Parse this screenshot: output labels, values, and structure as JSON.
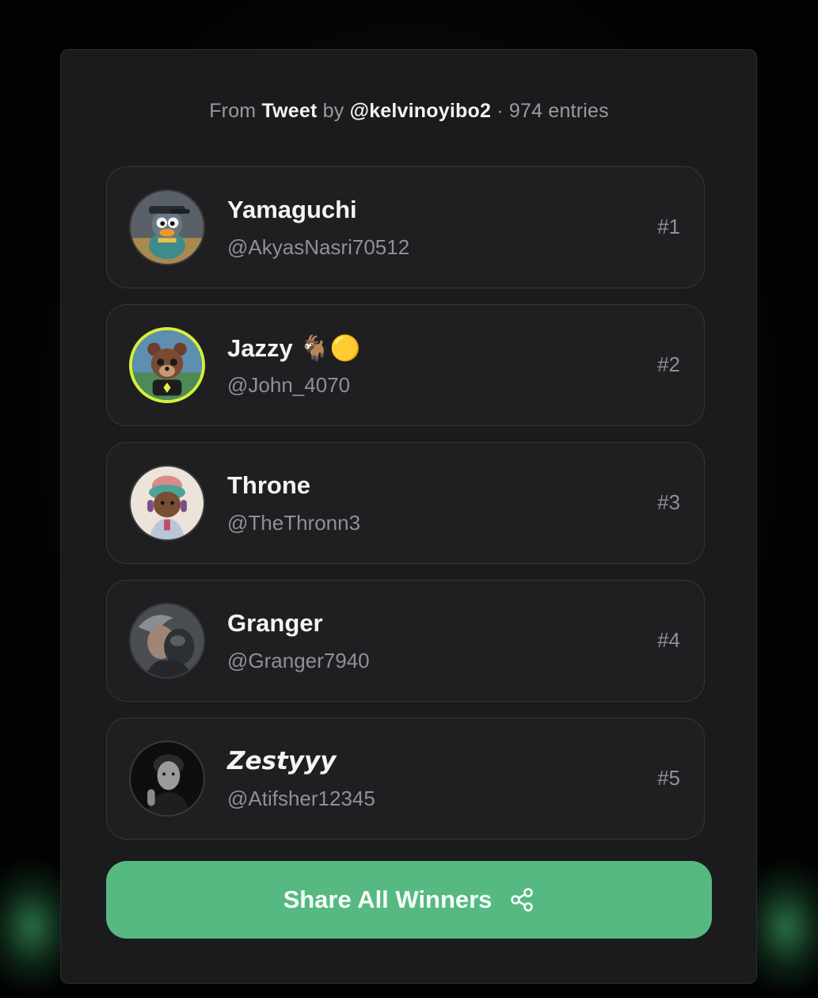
{
  "header": {
    "from_label": "From",
    "source_type": "Tweet",
    "by_label": "by",
    "author": "@kelvinoyibo2",
    "separator": "·",
    "entries": "974 entries"
  },
  "winners": [
    {
      "name": "Yamaguchi",
      "handle": "@AkyasNasri70512",
      "rank": "#1"
    },
    {
      "name": "Jazzy 🐐🟡",
      "handle": "@John_4070",
      "rank": "#2"
    },
    {
      "name": "Throne",
      "handle": "@TheThronn3",
      "rank": "#3"
    },
    {
      "name": "Granger",
      "handle": "@Granger7940",
      "rank": "#4"
    },
    {
      "name": "𝙕𝙚𝙨𝙩𝙮𝙮𝙮",
      "handle": "@Atifsher12345",
      "rank": "#5"
    }
  ],
  "share": {
    "label": "Share All Winners",
    "icon": "share-icon"
  },
  "colors": {
    "accent": "#56b981",
    "card_bg": "#1b1b1d",
    "item_bg": "#1f1f22",
    "avatar_ring_2": "#d4f03a"
  }
}
